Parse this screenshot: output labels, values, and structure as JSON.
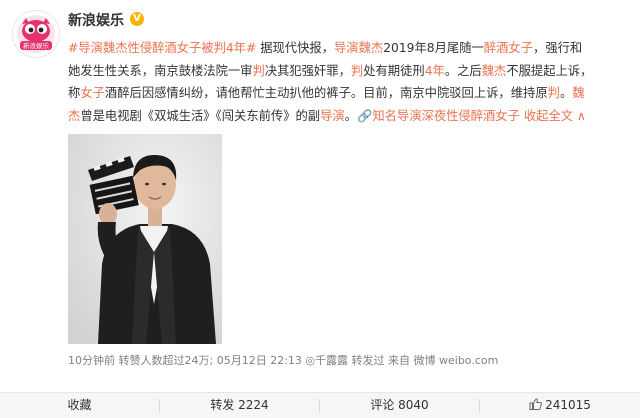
{
  "account": {
    "name": "新浪娱乐",
    "verified_mark": "V",
    "avatar_text": "新浪娱乐"
  },
  "post": {
    "lines": [
      {
        "segments": [
          {
            "text": "#导演魏杰性侵醉酒女子被判4年#",
            "style": "topic"
          },
          {
            "text": " 据现代快报，",
            "style": "plain"
          },
          {
            "text": "导演魏杰",
            "style": "hl"
          },
          {
            "text": "2019年8月尾随一",
            "style": "plain"
          },
          {
            "text": "醉酒女子",
            "style": "hl"
          },
          {
            "text": "，强行和",
            "style": "plain"
          }
        ]
      },
      {
        "segments": [
          {
            "text": "她发生性关系，南京鼓楼法院一审",
            "style": "plain"
          },
          {
            "text": "判",
            "style": "hl"
          },
          {
            "text": "决其犯强奸罪，",
            "style": "plain"
          },
          {
            "text": "判",
            "style": "hl"
          },
          {
            "text": "处有期徒刑",
            "style": "plain"
          },
          {
            "text": "4年",
            "style": "hl"
          },
          {
            "text": "。之后",
            "style": "plain"
          },
          {
            "text": "魏杰",
            "style": "hl"
          },
          {
            "text": "不服提起上诉，",
            "style": "plain"
          }
        ]
      },
      {
        "segments": [
          {
            "text": "称",
            "style": "plain"
          },
          {
            "text": "女子",
            "style": "hl"
          },
          {
            "text": "酒醉后因感情纠纷，请他帮忙主动扒他的裤子。目前，南京中院驳回上诉，维持原",
            "style": "plain"
          },
          {
            "text": "判",
            "style": "hl"
          },
          {
            "text": "。",
            "style": "plain"
          },
          {
            "text": "魏",
            "style": "hl"
          }
        ]
      },
      {
        "segments": [
          {
            "text": "杰",
            "style": "hl"
          },
          {
            "text": "曾是电视剧《双城生活》《闯关东前传》的副",
            "style": "plain"
          },
          {
            "text": "导演",
            "style": "hl"
          },
          {
            "text": "。",
            "style": "plain"
          },
          {
            "text": "🔗知名导演深夜性侵醉酒女子",
            "style": "link"
          },
          {
            "text": " 收起全文 ",
            "style": "link"
          },
          {
            "text": "∧",
            "style": "link"
          }
        ]
      }
    ]
  },
  "meta": {
    "time": "10分钟前",
    "reposts_text": " 转赞人数超过24万; ",
    "date": "05月12日 22:13",
    "via": " ◎千露露 ",
    "via_action": "转发过",
    "from_label": " 来自 ",
    "source": "微博 weibo.com"
  },
  "actions": {
    "favorite": "收藏",
    "repost": "转发 2224",
    "comment": "评论 8040",
    "like": "241015"
  },
  "colors": {
    "accent": "#eb7350",
    "text": "#333333",
    "meta": "#808080",
    "bar": "#f6f6f6",
    "verified": "#f6b400"
  }
}
